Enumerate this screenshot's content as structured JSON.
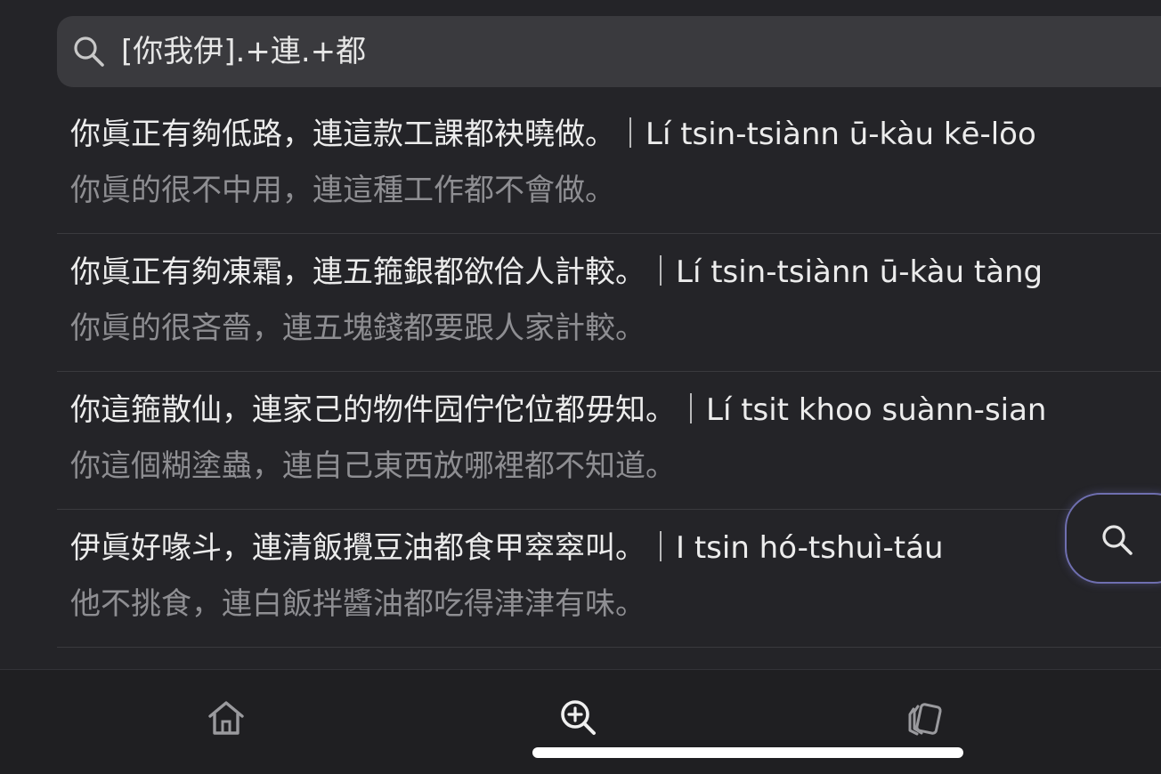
{
  "search": {
    "query": "[你我伊].+連.+都"
  },
  "results": [
    {
      "primary": "你眞正有夠低路，連這款工課都袂曉做。｜Lí tsin-tsiànn ū-kàu kē-lōo",
      "secondary": "你眞的很不中用，連這種工作都不會做。"
    },
    {
      "primary": "你眞正有夠凍霜，連五箍銀都欲佮人計較。｜Lí tsin-tsiànn ū-kàu tàng",
      "secondary": "你眞的很吝嗇，連五塊錢都要跟人家計較。"
    },
    {
      "primary": "你這箍散仙，連家己的物件囥佇佗位都毋知。｜Lí tsit khoo suànn-sian",
      "secondary": "你這個糊塗蟲，連自己東西放哪裡都不知道。"
    },
    {
      "primary": "伊眞好喙斗，連清飯攪豆油都食甲窣窣叫。｜I tsin hó-tshuì-táu",
      "secondary": "他不挑食，連白飯拌醬油都吃得津津有味。"
    }
  ],
  "tabs": [
    {
      "icon": "home-icon"
    },
    {
      "icon": "zoom-search-icon"
    },
    {
      "icon": "cards-icon"
    }
  ],
  "colors": {
    "background": "#242428",
    "search_bar": "#3a3a3e",
    "primary_text": "#ececec",
    "secondary_text": "#8e8e92",
    "fab_border": "#6f6fb0"
  }
}
